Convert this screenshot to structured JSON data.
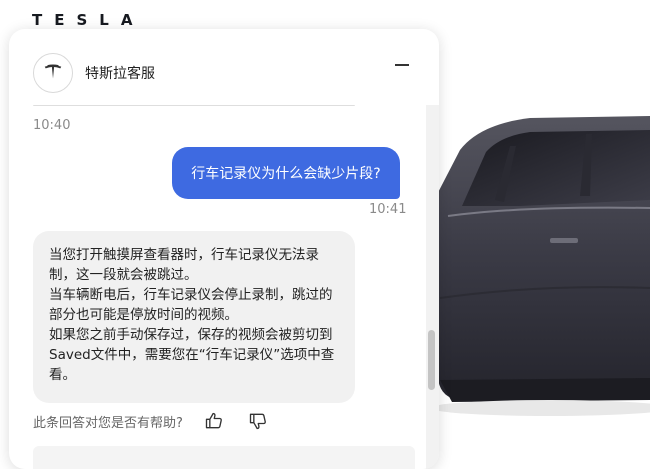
{
  "brand": {
    "logo_text": "TESLA"
  },
  "chat": {
    "title": "特斯拉客服",
    "icons": {
      "avatar": "tesla-logo-icon",
      "minimize": "minimize-icon",
      "thumbs_up": "thumbs-up-icon",
      "thumbs_down": "thumbs-down-icon"
    },
    "messages": [
      {
        "role": "timestamp",
        "text": "10:40"
      },
      {
        "role": "user",
        "text": "行车记录仪为什么会缺少片段?"
      },
      {
        "role": "timestamp",
        "text": "10:41"
      },
      {
        "role": "assistant",
        "paragraphs": [
          "当您打开触摸屏查看器时，行车记录仪无法录制，这一段就会被跳过。",
          "当车辆断电后，行车记录仪会停止录制，跳过的部分也可能是停放时间的视频。",
          "如果您之前手动保存过，保存的视频会被剪切到Saved文件中，需要您在“行车记录仪”选项中查看。"
        ]
      }
    ],
    "feedback_prompt": "此条回答对您是否有帮助?"
  },
  "colors": {
    "accent": "#3e6ae1",
    "bot_bubble": "#f1f1f1",
    "car_body": "#3a3a45"
  }
}
